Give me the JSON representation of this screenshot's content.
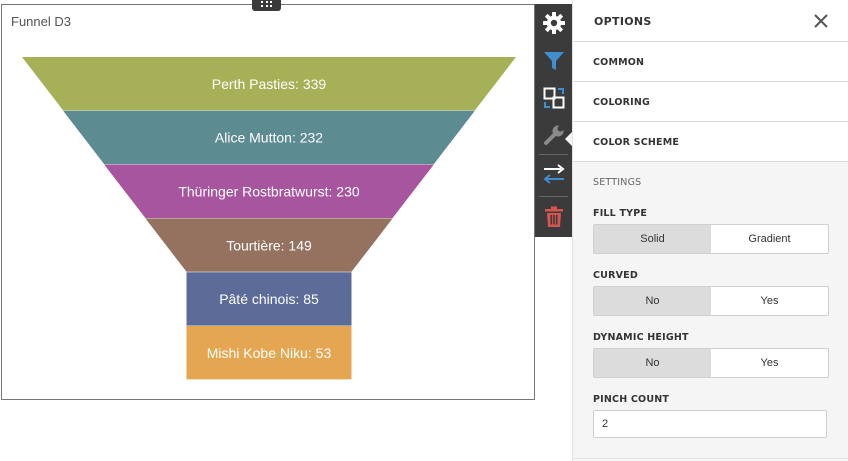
{
  "item": {
    "title": "Funnel D3"
  },
  "chart_data": {
    "type": "funnel",
    "title": "Funnel D3",
    "categories": [
      "Perth Pasties",
      "Alice Mutton",
      "Thüringer Rostbratwurst",
      "Tourtière",
      "Pâté chinois",
      "Mishi Kobe Niku"
    ],
    "values": [
      339,
      232,
      230,
      149,
      85,
      53
    ],
    "labels": [
      "Perth Pasties: 339",
      "Alice Mutton: 232",
      "Thüringer Rostbratwurst: 230",
      "Tourtière: 149",
      "Pâté chinois: 85",
      "Mishi Kobe Niku: 53"
    ],
    "colors": [
      "#a6b056",
      "#5c8b92",
      "#a855a0",
      "#957260",
      "#5d6b98",
      "#e5a651"
    ],
    "fill_type": "Solid",
    "curved": false,
    "dynamic_height": false,
    "pinch_count": 2
  },
  "toolbar": {
    "buttons": [
      "gear-icon",
      "filter-icon",
      "interactivity-icon",
      "wrench-icon",
      "convert-icon",
      "trash-icon"
    ],
    "colors": {
      "accent": "#3e8ed0",
      "danger": "#d9534f",
      "icon": "#ffffff",
      "muted": "#8a8a8a"
    }
  },
  "panel": {
    "title": "OPTIONS",
    "sections": [
      "COMMON",
      "COLORING",
      "COLOR SCHEME"
    ],
    "settings_title": "SETTINGS",
    "fill_type": {
      "label": "FILL TYPE",
      "options": [
        "Solid",
        "Gradient"
      ],
      "selected": "Solid"
    },
    "curved": {
      "label": "CURVED",
      "options": [
        "No",
        "Yes"
      ],
      "selected": "No"
    },
    "dynamic_height": {
      "label": "DYNAMIC HEIGHT",
      "options": [
        "No",
        "Yes"
      ],
      "selected": "No"
    },
    "pinch_count": {
      "label": "PINCH COUNT",
      "value": "2"
    }
  }
}
